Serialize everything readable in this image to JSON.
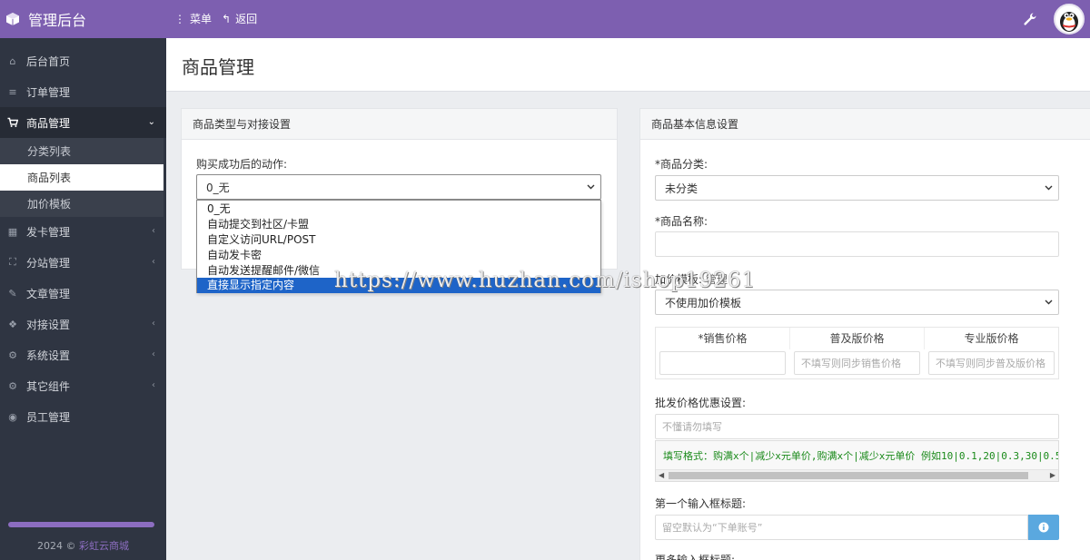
{
  "app": {
    "title": "管理后台",
    "menu_label": "菜单",
    "back_label": "返回"
  },
  "colors": {
    "brand": "#7d5fb0",
    "sidebar_bg": "#2f3542",
    "select_highlight": "#1e64c8",
    "info_button": "#5aa8df",
    "hint_text": "#1a8a1a"
  },
  "sidebar": {
    "items": [
      {
        "label": "后台首页",
        "icon": "home-icon"
      },
      {
        "label": "订单管理",
        "icon": "list-icon"
      },
      {
        "label": "商品管理",
        "icon": "cart-icon",
        "expanded": true
      },
      {
        "label": "发卡管理",
        "icon": "grid-icon"
      },
      {
        "label": "分站管理",
        "icon": "sitemap-icon"
      },
      {
        "label": "文章管理",
        "icon": "edit-icon"
      },
      {
        "label": "对接设置",
        "icon": "cubes-icon"
      },
      {
        "label": "系统设置",
        "icon": "gear-icon"
      },
      {
        "label": "其它组件",
        "icon": "cogs-icon"
      },
      {
        "label": "员工管理",
        "icon": "user-icon"
      }
    ],
    "sub_items": [
      {
        "label": "分类列表"
      },
      {
        "label": "商品列表",
        "active": true
      },
      {
        "label": "加价模板"
      }
    ],
    "copyright_year": "2024 ©",
    "copyright_name": "彩虹云商城"
  },
  "page": {
    "title": "商品管理"
  },
  "left_panel": {
    "heading": "商品类型与对接设置",
    "action_label": "购买成功后的动作:",
    "action_value": "0_无",
    "options": [
      "0_无",
      "自动提交到社区/卡盟",
      "自定义访问URL/POST",
      "自动发卡密",
      "自动发送提醒邮件/微信",
      "直接显示指定内容"
    ],
    "highlighted_option": "直接显示指定内容"
  },
  "right_panel": {
    "heading": "商品基本信息设置",
    "category_label": "*商品分类:",
    "category_value": "未分类",
    "name_label": "*商品名称:",
    "name_value": "",
    "markup_label": "加价模板:",
    "markup_manage": "管理",
    "markup_value": "不使用加价模板",
    "price_headers": [
      "*销售价格",
      "普及版价格",
      "专业版价格"
    ],
    "price_placeholders": [
      "",
      "不填写则同步销售价格",
      "不填写则同步普及版价格"
    ],
    "wholesale_label": "批发价格优惠设置:",
    "wholesale_placeholder": "不懂请勿填写",
    "wholesale_hint": "填写格式：购满x个|减少x元单价,购满x个|减少x元单价  例如10|0.1,20|0.3,30|0.5",
    "first_input_label": "第一个输入框标题:",
    "first_input_placeholder": "留空默认为“下单账号”",
    "more_input_label": "更多输入框标题:"
  },
  "watermark": "https://www.huzhan.com/ishop19261"
}
